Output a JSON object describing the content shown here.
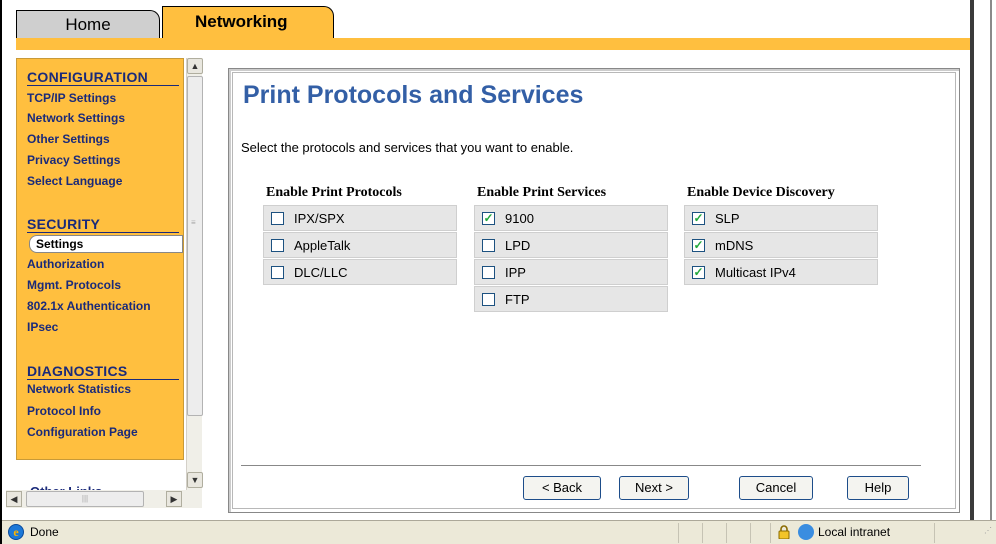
{
  "tabs": [
    {
      "label": "Home",
      "selected": false
    },
    {
      "label": "Networking",
      "selected": true
    }
  ],
  "nav": {
    "configuration": {
      "heading": "CONFIGURATION",
      "items": [
        "TCP/IP Settings",
        "Network Settings",
        "Other Settings",
        "Privacy Settings",
        "Select Language"
      ]
    },
    "security": {
      "heading": "SECURITY",
      "items": [
        "Settings",
        "Authorization",
        "Mgmt. Protocols",
        "802.1x Authentication",
        "IPsec"
      ],
      "selected": "Settings"
    },
    "diagnostics": {
      "heading": "DIAGNOSTICS",
      "items": [
        "Network Statistics",
        "Protocol Info",
        "Configuration Page"
      ]
    },
    "other_links": "Other Links"
  },
  "main": {
    "title": "Print Protocols and Services",
    "instruction": "Select the protocols and services that you want to enable.",
    "columns": [
      {
        "heading": "Enable Print Protocols",
        "options": [
          {
            "label": "IPX/SPX",
            "checked": false
          },
          {
            "label": "AppleTalk",
            "checked": false
          },
          {
            "label": "DLC/LLC",
            "checked": false
          }
        ]
      },
      {
        "heading": "Enable Print Services",
        "options": [
          {
            "label": "9100",
            "checked": true
          },
          {
            "label": "LPD",
            "checked": false
          },
          {
            "label": "IPP",
            "checked": false
          },
          {
            "label": "FTP",
            "checked": false
          }
        ]
      },
      {
        "heading": "Enable Device Discovery",
        "options": [
          {
            "label": "SLP",
            "checked": true
          },
          {
            "label": "mDNS",
            "checked": true
          },
          {
            "label": "Multicast IPv4",
            "checked": true
          }
        ]
      }
    ],
    "buttons": {
      "back": "< Back",
      "next": "Next >",
      "cancel": "Cancel",
      "help": "Help"
    }
  },
  "status": {
    "text": "Done",
    "zone": "Local intranet",
    "icons": [
      "ie-page-icon",
      "lock-icon",
      "globe-icon"
    ]
  },
  "colors": {
    "accent": "#ffbf3f",
    "title": "#335fa6",
    "nav_text": "#1a2a7a",
    "check": "#22a83c"
  }
}
